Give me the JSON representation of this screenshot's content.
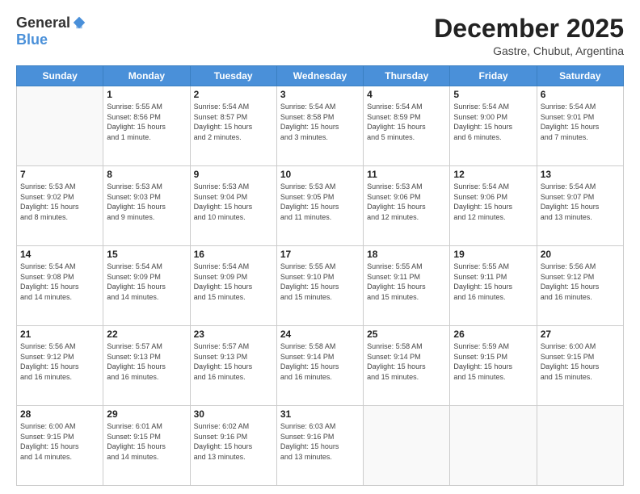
{
  "logo": {
    "general": "General",
    "blue": "Blue"
  },
  "header": {
    "month": "December 2025",
    "location": "Gastre, Chubut, Argentina"
  },
  "weekdays": [
    "Sunday",
    "Monday",
    "Tuesday",
    "Wednesday",
    "Thursday",
    "Friday",
    "Saturday"
  ],
  "weeks": [
    [
      {
        "day": "",
        "info": ""
      },
      {
        "day": "1",
        "info": "Sunrise: 5:55 AM\nSunset: 8:56 PM\nDaylight: 15 hours\nand 1 minute."
      },
      {
        "day": "2",
        "info": "Sunrise: 5:54 AM\nSunset: 8:57 PM\nDaylight: 15 hours\nand 2 minutes."
      },
      {
        "day": "3",
        "info": "Sunrise: 5:54 AM\nSunset: 8:58 PM\nDaylight: 15 hours\nand 3 minutes."
      },
      {
        "day": "4",
        "info": "Sunrise: 5:54 AM\nSunset: 8:59 PM\nDaylight: 15 hours\nand 5 minutes."
      },
      {
        "day": "5",
        "info": "Sunrise: 5:54 AM\nSunset: 9:00 PM\nDaylight: 15 hours\nand 6 minutes."
      },
      {
        "day": "6",
        "info": "Sunrise: 5:54 AM\nSunset: 9:01 PM\nDaylight: 15 hours\nand 7 minutes."
      }
    ],
    [
      {
        "day": "7",
        "info": "Sunrise: 5:53 AM\nSunset: 9:02 PM\nDaylight: 15 hours\nand 8 minutes."
      },
      {
        "day": "8",
        "info": "Sunrise: 5:53 AM\nSunset: 9:03 PM\nDaylight: 15 hours\nand 9 minutes."
      },
      {
        "day": "9",
        "info": "Sunrise: 5:53 AM\nSunset: 9:04 PM\nDaylight: 15 hours\nand 10 minutes."
      },
      {
        "day": "10",
        "info": "Sunrise: 5:53 AM\nSunset: 9:05 PM\nDaylight: 15 hours\nand 11 minutes."
      },
      {
        "day": "11",
        "info": "Sunrise: 5:53 AM\nSunset: 9:06 PM\nDaylight: 15 hours\nand 12 minutes."
      },
      {
        "day": "12",
        "info": "Sunrise: 5:54 AM\nSunset: 9:06 PM\nDaylight: 15 hours\nand 12 minutes."
      },
      {
        "day": "13",
        "info": "Sunrise: 5:54 AM\nSunset: 9:07 PM\nDaylight: 15 hours\nand 13 minutes."
      }
    ],
    [
      {
        "day": "14",
        "info": "Sunrise: 5:54 AM\nSunset: 9:08 PM\nDaylight: 15 hours\nand 14 minutes."
      },
      {
        "day": "15",
        "info": "Sunrise: 5:54 AM\nSunset: 9:09 PM\nDaylight: 15 hours\nand 14 minutes."
      },
      {
        "day": "16",
        "info": "Sunrise: 5:54 AM\nSunset: 9:09 PM\nDaylight: 15 hours\nand 15 minutes."
      },
      {
        "day": "17",
        "info": "Sunrise: 5:55 AM\nSunset: 9:10 PM\nDaylight: 15 hours\nand 15 minutes."
      },
      {
        "day": "18",
        "info": "Sunrise: 5:55 AM\nSunset: 9:11 PM\nDaylight: 15 hours\nand 15 minutes."
      },
      {
        "day": "19",
        "info": "Sunrise: 5:55 AM\nSunset: 9:11 PM\nDaylight: 15 hours\nand 16 minutes."
      },
      {
        "day": "20",
        "info": "Sunrise: 5:56 AM\nSunset: 9:12 PM\nDaylight: 15 hours\nand 16 minutes."
      }
    ],
    [
      {
        "day": "21",
        "info": "Sunrise: 5:56 AM\nSunset: 9:12 PM\nDaylight: 15 hours\nand 16 minutes."
      },
      {
        "day": "22",
        "info": "Sunrise: 5:57 AM\nSunset: 9:13 PM\nDaylight: 15 hours\nand 16 minutes."
      },
      {
        "day": "23",
        "info": "Sunrise: 5:57 AM\nSunset: 9:13 PM\nDaylight: 15 hours\nand 16 minutes."
      },
      {
        "day": "24",
        "info": "Sunrise: 5:58 AM\nSunset: 9:14 PM\nDaylight: 15 hours\nand 16 minutes."
      },
      {
        "day": "25",
        "info": "Sunrise: 5:58 AM\nSunset: 9:14 PM\nDaylight: 15 hours\nand 15 minutes."
      },
      {
        "day": "26",
        "info": "Sunrise: 5:59 AM\nSunset: 9:15 PM\nDaylight: 15 hours\nand 15 minutes."
      },
      {
        "day": "27",
        "info": "Sunrise: 6:00 AM\nSunset: 9:15 PM\nDaylight: 15 hours\nand 15 minutes."
      }
    ],
    [
      {
        "day": "28",
        "info": "Sunrise: 6:00 AM\nSunset: 9:15 PM\nDaylight: 15 hours\nand 14 minutes."
      },
      {
        "day": "29",
        "info": "Sunrise: 6:01 AM\nSunset: 9:15 PM\nDaylight: 15 hours\nand 14 minutes."
      },
      {
        "day": "30",
        "info": "Sunrise: 6:02 AM\nSunset: 9:16 PM\nDaylight: 15 hours\nand 13 minutes."
      },
      {
        "day": "31",
        "info": "Sunrise: 6:03 AM\nSunset: 9:16 PM\nDaylight: 15 hours\nand 13 minutes."
      },
      {
        "day": "",
        "info": ""
      },
      {
        "day": "",
        "info": ""
      },
      {
        "day": "",
        "info": ""
      }
    ]
  ]
}
